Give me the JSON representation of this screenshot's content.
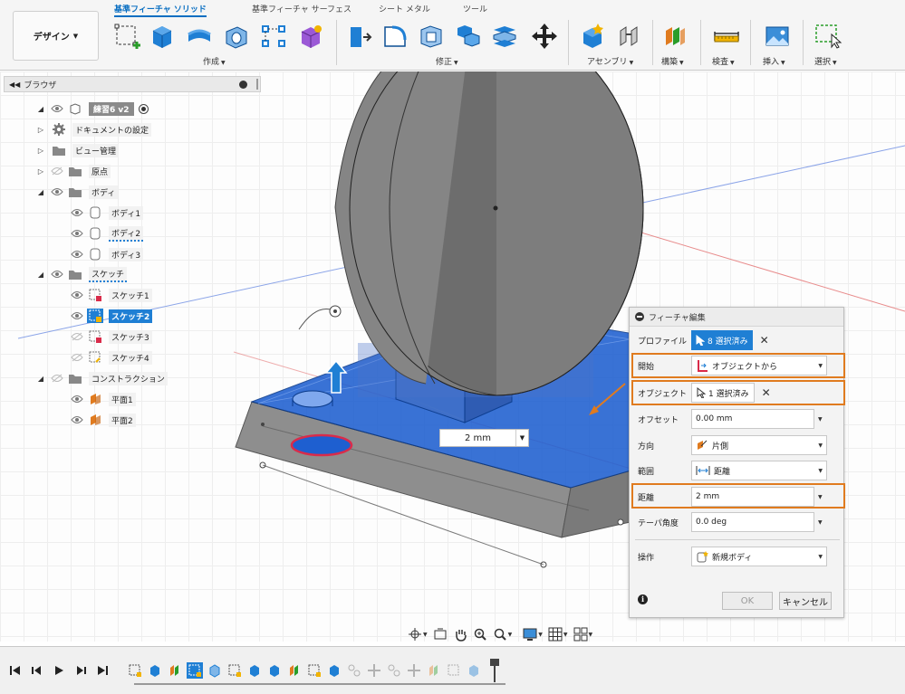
{
  "workspace": {
    "label": "デザイン"
  },
  "tabs": [
    {
      "label": "基準フィーチャ ソリッド",
      "active": true
    },
    {
      "label": "基準フィーチャ サーフェス",
      "active": false
    },
    {
      "label": "シート メタル",
      "active": false
    },
    {
      "label": "ツール",
      "active": false
    }
  ],
  "toolbar_groups": [
    {
      "label": "作成"
    },
    {
      "label": "修正"
    },
    {
      "label": "アセンブリ"
    },
    {
      "label": "構築"
    },
    {
      "label": "検査"
    },
    {
      "label": "挿入"
    },
    {
      "label": "選択"
    }
  ],
  "browser": {
    "title": "ブラウザ",
    "root": "練習6 v2",
    "nodes": [
      {
        "label": "ドキュメントの設定"
      },
      {
        "label": "ビュー管理"
      },
      {
        "label": "原点"
      },
      {
        "label": "ボディ"
      },
      {
        "label": "ボディ1"
      },
      {
        "label": "ボディ2"
      },
      {
        "label": "ボディ3"
      },
      {
        "label": "スケッチ"
      },
      {
        "label": "スケッチ1"
      },
      {
        "label": "スケッチ2"
      },
      {
        "label": "スケッチ3"
      },
      {
        "label": "スケッチ4"
      },
      {
        "label": "コンストラクション"
      },
      {
        "label": "平面1"
      },
      {
        "label": "平面2"
      }
    ]
  },
  "viewport": {
    "distance_input": "2 mm"
  },
  "dialog": {
    "title": "フィーチャ編集",
    "profile": {
      "label": "プロファイル",
      "value": "8 選択済み"
    },
    "start": {
      "label": "開始",
      "value": "オブジェクトから"
    },
    "object": {
      "label": "オブジェクト",
      "value": "1 選択済み"
    },
    "offset": {
      "label": "オフセット",
      "value": "0.00 mm"
    },
    "direction": {
      "label": "方向",
      "value": "片側"
    },
    "extent": {
      "label": "範囲",
      "value": "距離"
    },
    "distance": {
      "label": "距離",
      "value": "2 mm"
    },
    "taper": {
      "label": "テーパ角度",
      "value": "0.0 deg"
    },
    "operation": {
      "label": "操作",
      "value": "新規ボディ"
    },
    "ok": "OK",
    "cancel": "キャンセル"
  },
  "colors": {
    "accent": "#1f7fd4",
    "highlight": "#e07b1f",
    "selection_face": "#1e5fd0"
  }
}
